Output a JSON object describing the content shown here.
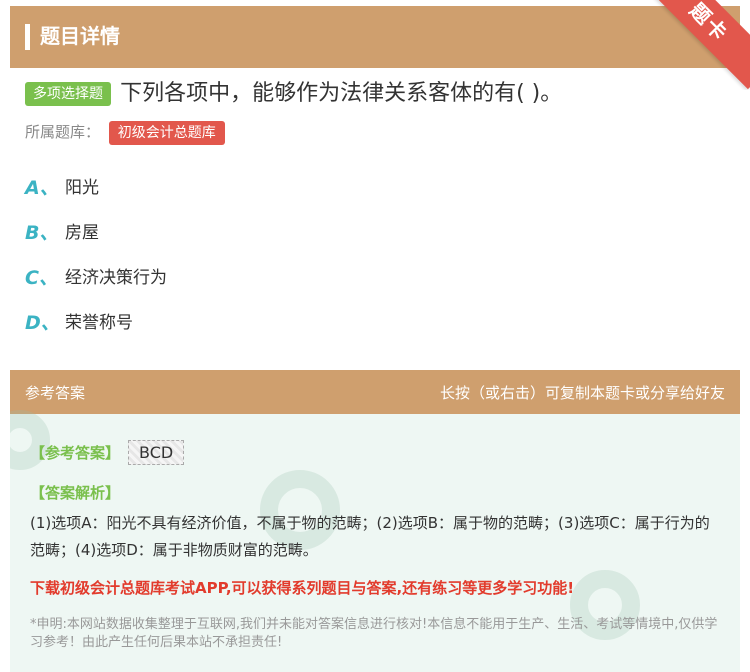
{
  "header": {
    "title": "题目详情",
    "ribbon": "题卡"
  },
  "question": {
    "type_tag": "多项选择题",
    "text": "下列各项中，能够作为法律关系客体的有( )。",
    "bank_label": "所属题库：",
    "bank_name": "初级会计总题库"
  },
  "options": [
    {
      "letter": "A、",
      "text": "阳光"
    },
    {
      "letter": "B、",
      "text": "房屋"
    },
    {
      "letter": "C、",
      "text": "经济决策行为"
    },
    {
      "letter": "D、",
      "text": "荣誉称号"
    }
  ],
  "answer": {
    "header_left": "参考答案",
    "header_right": "长按（或右击）可复制本题卡或分享给好友",
    "ref_label": "【参考答案】",
    "ref_value": "BCD",
    "analysis_label": "【答案解析】",
    "analysis_text": "(1)选项A：阳光不具有经济价值，不属于物的范畴；(2)选项B：属于物的范畴；(3)选项C：属于行为的范畴；(4)选项D：属于非物质财富的范畴。",
    "promo": "下载初级会计总题库考试APP,可以获得系列题目与答案,还有练习等更多学习功能!",
    "disclaimer": "*申明:本网站数据收集整理于互联网,我们并未能对答案信息进行核对!本信息不能用于生产、生活、考试等情境中,仅供学习参考！由此产生任何后果本站不承担责任!"
  },
  "colors": {
    "header_bg": "#cf9f6e",
    "type_tag_bg": "#7ac04d",
    "bank_tag_bg": "#e2574c",
    "option_letter": "#3bb3c3",
    "promo": "#e23b2c"
  }
}
